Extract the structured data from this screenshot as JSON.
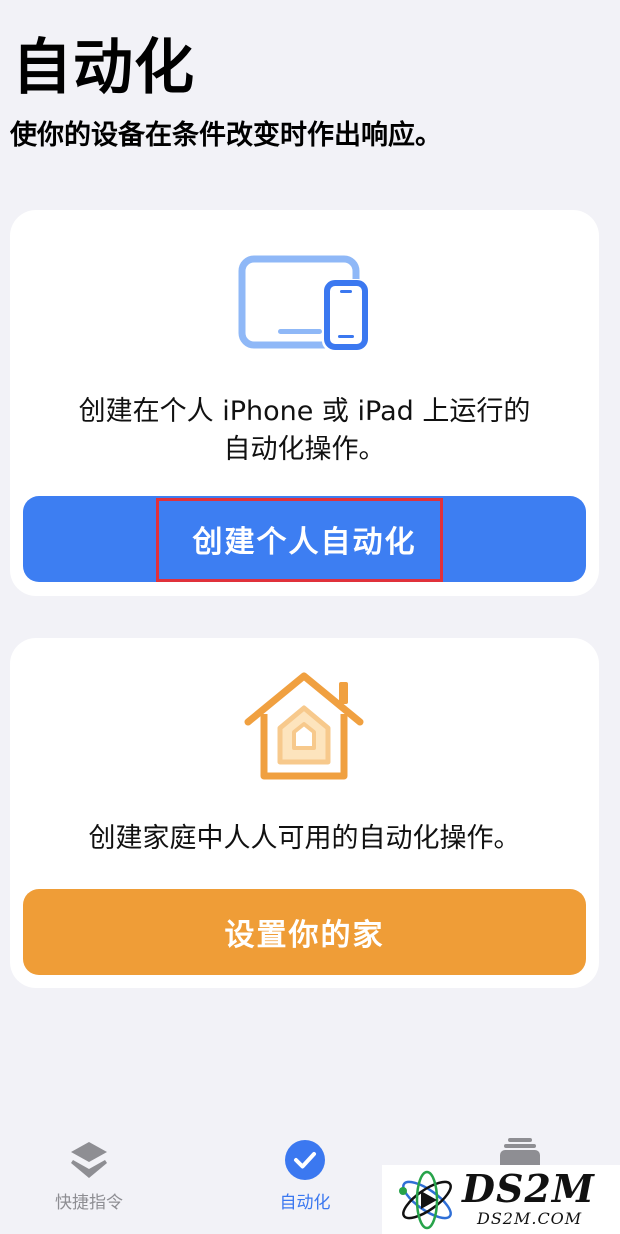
{
  "header": {
    "title": "自动化",
    "subtitle": "使你的设备在条件改变时作出响应。"
  },
  "personal_card": {
    "icon": "ipad-iphone-icon",
    "description_line1": "创建在个人 iPhone 或 iPad 上运行的",
    "description_line2": "自动化操作。",
    "button_label": "创建个人自动化",
    "button_color": "#3d7ef2"
  },
  "home_card": {
    "icon": "home-icon",
    "description": "创建家庭中人人可用的自动化操作。",
    "button_label": "设置你的家",
    "button_color": "#ef9d37"
  },
  "tabbar": {
    "tabs": [
      {
        "label": "快捷指令",
        "icon": "layers-icon",
        "active": false
      },
      {
        "label": "自动化",
        "icon": "checkmark-circle-icon",
        "active": true
      },
      {
        "label": "",
        "icon": "gallery-stack-icon",
        "active": false
      }
    ]
  },
  "watermark": {
    "logo_text": "DS2M",
    "url": "DS2M.COM"
  },
  "colors": {
    "background": "#f2f2f7",
    "accent_blue": "#3b78f0",
    "accent_orange": "#ef9d37",
    "highlight_red": "#e0313b"
  }
}
